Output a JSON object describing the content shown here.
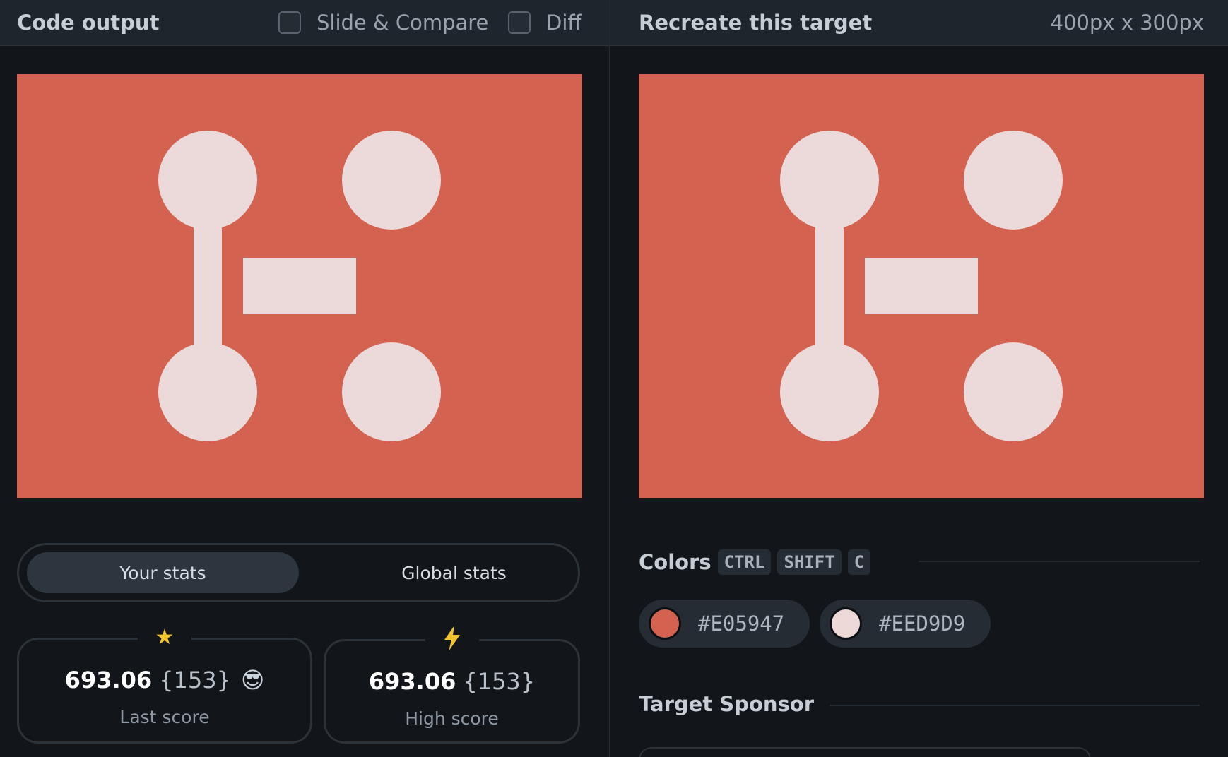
{
  "left_pane": {
    "title": "Code output",
    "slide_compare_label": "Slide & Compare",
    "diff_label": "Diff"
  },
  "right_pane": {
    "title": "Recreate this target",
    "size_label": "400px x 300px"
  },
  "target": {
    "background_color": "#D36350",
    "shape_color": "#EBDAD9"
  },
  "stats_toggle": {
    "your_stats": "Your stats",
    "global_stats": "Global stats",
    "active": "your_stats"
  },
  "stats": {
    "last": {
      "score": "693.06",
      "count": "{153}",
      "emoji": "😎",
      "label": "Last score",
      "icon": "star-icon"
    },
    "high": {
      "score": "693.06",
      "count": "{153}",
      "label": "High score",
      "icon": "lightning-icon"
    }
  },
  "colors_section": {
    "title": "Colors",
    "shortcut_keys": [
      "CTRL",
      "SHIFT",
      "C"
    ],
    "swatches": [
      {
        "hex": "#E05947",
        "swatch": "#D36350"
      },
      {
        "hex": "#EED9D9",
        "swatch": "#EED9D9"
      }
    ]
  },
  "sponsor_section": {
    "title": "Target Sponsor"
  }
}
